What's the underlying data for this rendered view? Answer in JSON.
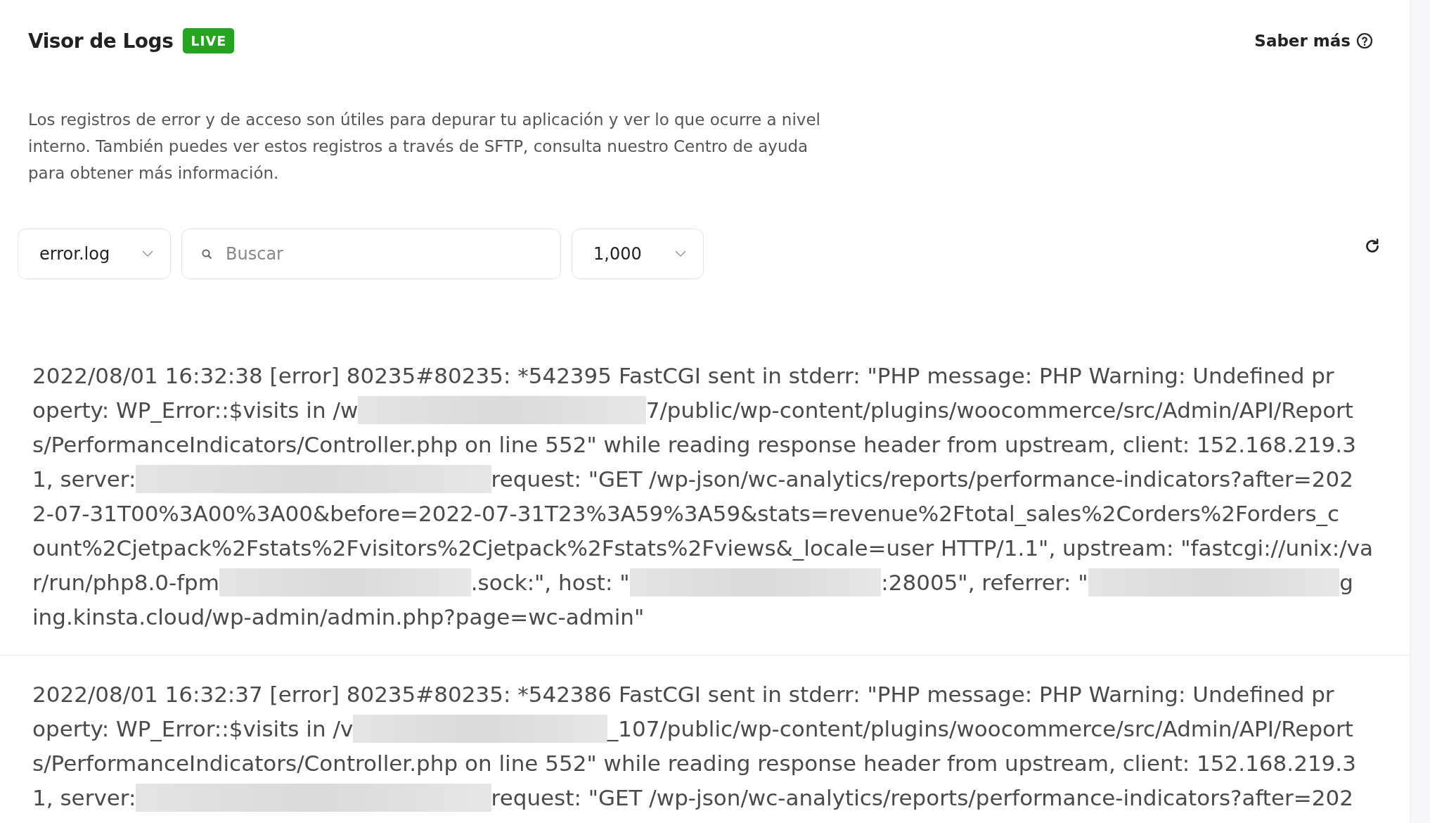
{
  "header": {
    "title": "Visor de Logs",
    "badge": "LIVE",
    "help_link": "Saber más"
  },
  "description": "Los registros de error y de acceso son útiles para depurar tu aplicación y ver lo que ocurre a nivel interno. También puedes ver estos registros a través de SFTP, consulta nuestro Centro de ayuda para obtener más información.",
  "toolbar": {
    "file_select": "error.log",
    "search": {
      "placeholder": "Buscar"
    },
    "lines_select": "1,000"
  },
  "log_entries": [
    {
      "lines": [
        [
          {
            "kind": "text",
            "text": "2022/08/01 16:32:38 [error] 80235#80235: *542395 FastCGI sent in stderr: \"PHP message: PHP Warning: Undefined pr"
          }
        ],
        [
          {
            "kind": "text",
            "text": "operty: WP_Error::$visits in /w"
          },
          {
            "kind": "redacted"
          },
          {
            "kind": "text",
            "text": "7/public/wp-content/plugins/woocommerce/src/Admin/API/Report"
          }
        ],
        [
          {
            "kind": "text",
            "text": "s/PerformanceIndicators/Controller.php on line 552\" while reading response header from upstream, client: 152.168.219.3"
          }
        ],
        [
          {
            "kind": "text",
            "text": "1, server: "
          },
          {
            "kind": "redacted"
          },
          {
            "kind": "text",
            "text": " request: \"GET /wp-json/wc-analytics/reports/performance-indicators?after=202"
          }
        ],
        [
          {
            "kind": "text",
            "text": "2-07-31T00%3A00%3A00&before=2022-07-31T23%3A59%3A59&stats=revenue%2Ftotal_sales%2Corders%2Forders_c"
          }
        ],
        [
          {
            "kind": "text",
            "text": "ount%2Cjetpack%2Fstats%2Fvisitors%2Cjetpack%2Fstats%2Fviews&_locale=user HTTP/1.1\", upstream: \"fastcgi://unix:/va"
          }
        ],
        [
          {
            "kind": "text",
            "text": "r/run/php8.0-fpm"
          },
          {
            "kind": "redacted"
          },
          {
            "kind": "text",
            "text": ".sock:\", host: \""
          },
          {
            "kind": "redacted"
          },
          {
            "kind": "text",
            "text": ":28005\", referrer: \""
          },
          {
            "kind": "redacted"
          },
          {
            "kind": "text",
            "text": "g"
          }
        ],
        [
          {
            "kind": "text",
            "text": "ing.kinsta.cloud/wp-admin/admin.php?page=wc-admin\""
          }
        ]
      ]
    },
    {
      "lines": [
        [
          {
            "kind": "text",
            "text": "2022/08/01 16:32:37 [error] 80235#80235: *542386 FastCGI sent in stderr: \"PHP message: PHP Warning: Undefined pr"
          }
        ],
        [
          {
            "kind": "text",
            "text": "operty: WP_Error::$visits in /v"
          },
          {
            "kind": "redacted"
          },
          {
            "kind": "text",
            "text": "_107/public/wp-content/plugins/woocommerce/src/Admin/API/Report"
          }
        ],
        [
          {
            "kind": "text",
            "text": "s/PerformanceIndicators/Controller.php on line 552\" while reading response header from upstream, client: 152.168.219.3"
          }
        ],
        [
          {
            "kind": "text",
            "text": "1, server: "
          },
          {
            "kind": "redacted"
          },
          {
            "kind": "text",
            "text": " request: \"GET /wp-json/wc-analytics/reports/performance-indicators?after=202"
          }
        ]
      ]
    }
  ]
}
